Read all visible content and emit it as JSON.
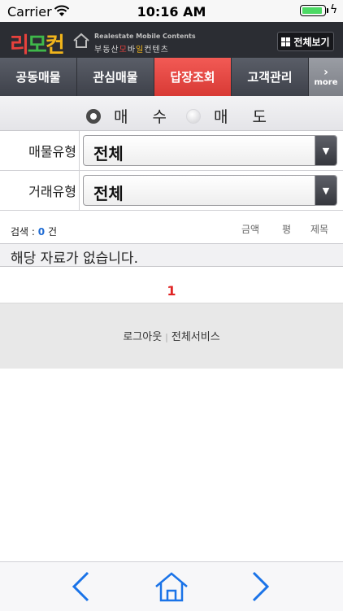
{
  "status_bar": {
    "carrier": "Carrier",
    "time": "10:16 AM",
    "battery_level": 0.95
  },
  "header": {
    "logo_parts": [
      "리",
      "모",
      "컨"
    ],
    "brand_en": "Realestate Mobile Contents",
    "brand_ko_parts": [
      "부동산",
      "모",
      "바",
      "일",
      "컨텐츠"
    ],
    "all_view_label": "전체보기"
  },
  "tabs": [
    {
      "label": "공동매물",
      "active": false
    },
    {
      "label": "관심매물",
      "active": false
    },
    {
      "label": "답장조회",
      "active": true
    },
    {
      "label": "고객관리",
      "active": false
    }
  ],
  "more_tab": {
    "arrow": "›",
    "label": "more"
  },
  "trade_radio": {
    "options": [
      {
        "label": "매수",
        "selected": true
      },
      {
        "label": "매도",
        "selected": false
      }
    ]
  },
  "filters": [
    {
      "label": "매물유형",
      "value": "전체"
    },
    {
      "label": "거래유형",
      "value": "전체"
    }
  ],
  "results": {
    "count_prefix": "검색 : ",
    "count": "0",
    "count_suffix": " 건",
    "sort_options": [
      "금액",
      "평",
      "제목"
    ],
    "no_data_text": "해당 자료가 없습니다.",
    "page": "1"
  },
  "footer": {
    "logout": "로그아웃",
    "all_services": "전체서비스"
  },
  "toolbar": {
    "icons": [
      "back-arrow-icon",
      "home-icon",
      "forward-arrow-icon"
    ],
    "accent": "#1a73e8"
  },
  "colors": {
    "header_bg": "#2b2d33",
    "active_tab": "#e8413c",
    "count_blue": "#1f6bd3",
    "page_red": "#e02424"
  }
}
